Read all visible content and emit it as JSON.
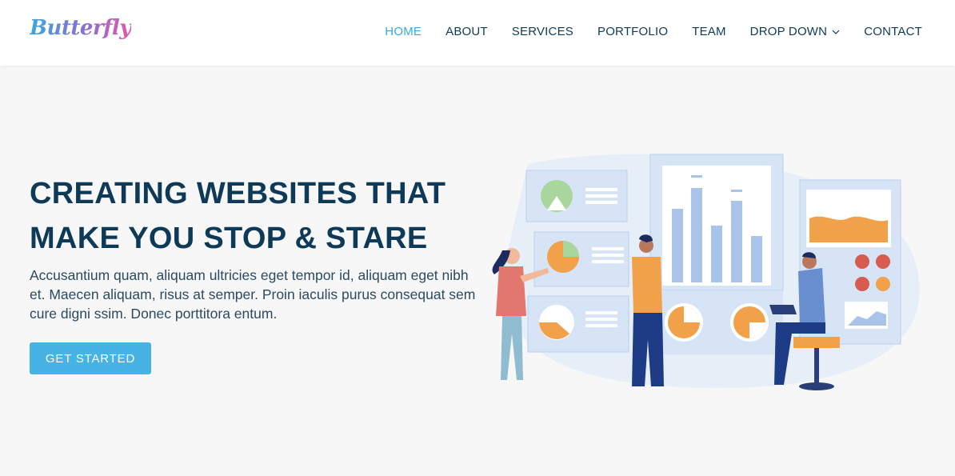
{
  "brand": {
    "logo_text": "Butterfly"
  },
  "nav": {
    "items": [
      {
        "label": "HOME",
        "active": true
      },
      {
        "label": "ABOUT"
      },
      {
        "label": "SERVICES"
      },
      {
        "label": "PORTFOLIO"
      },
      {
        "label": "TEAM"
      },
      {
        "label": "DROP DOWN",
        "icon": "chevron-down-icon"
      },
      {
        "label": "CONTACT"
      }
    ]
  },
  "hero": {
    "title_line1": "CREATING WEBSITES THAT",
    "title_line2": "MAKE YOU STOP & STARE",
    "description": "Accusantium quam, aliquam ultricies eget tempor id, aliquam eget nibh et. Maecen aliquam, risus at semper. Proin iaculis purus consequat sem cure digni ssim. Donec porttitora entum.",
    "cta_label": "GET STARTED"
  },
  "colors": {
    "accent": "#47b2e4",
    "heading": "#0e3a57",
    "background": "#f7f7f7"
  }
}
